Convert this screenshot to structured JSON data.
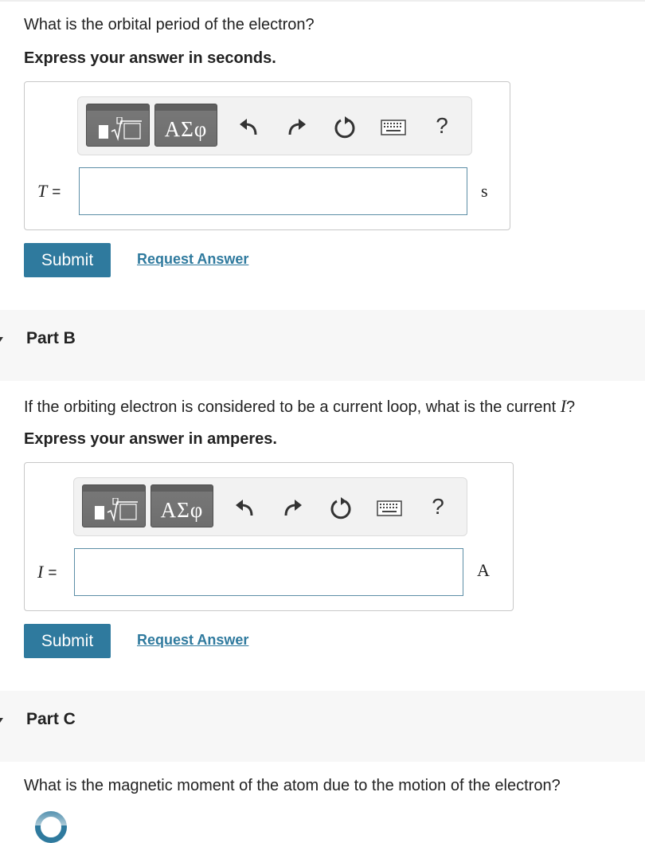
{
  "part_a": {
    "question": "What is the orbital period of the electron?",
    "instruction": "Express your answer in seconds.",
    "variable": "T",
    "equals": "=",
    "input_value": "",
    "unit": "s",
    "toolbar": {
      "symbols_label": "ΑΣφ",
      "help_label": "?"
    },
    "submit_label": "Submit",
    "request_label": "Request Answer"
  },
  "part_b": {
    "header": "Part B",
    "question_prefix": "If the orbiting electron is considered to be a current loop, what is the current ",
    "question_var": "I",
    "question_suffix": "?",
    "instruction": "Express your answer in amperes.",
    "variable": "I",
    "equals": "=",
    "input_value": "",
    "unit": "A",
    "toolbar": {
      "symbols_label": "ΑΣφ",
      "help_label": "?"
    },
    "submit_label": "Submit",
    "request_label": "Request Answer"
  },
  "part_c": {
    "header": "Part C",
    "question": "What is the magnetic moment of the atom due to the motion of the electron?"
  },
  "icons": {
    "templates": "templates-icon",
    "undo": "undo-icon",
    "redo": "redo-icon",
    "reset": "reset-icon",
    "keyboard": "keyboard-icon",
    "help": "help-icon",
    "collapse": "caret-down-icon"
  },
  "colors": {
    "accent": "#2f7a9e",
    "toolbar_button": "#6e6e6e",
    "part_header_bg": "#f7f7f7",
    "input_border": "#5c8ea6"
  }
}
